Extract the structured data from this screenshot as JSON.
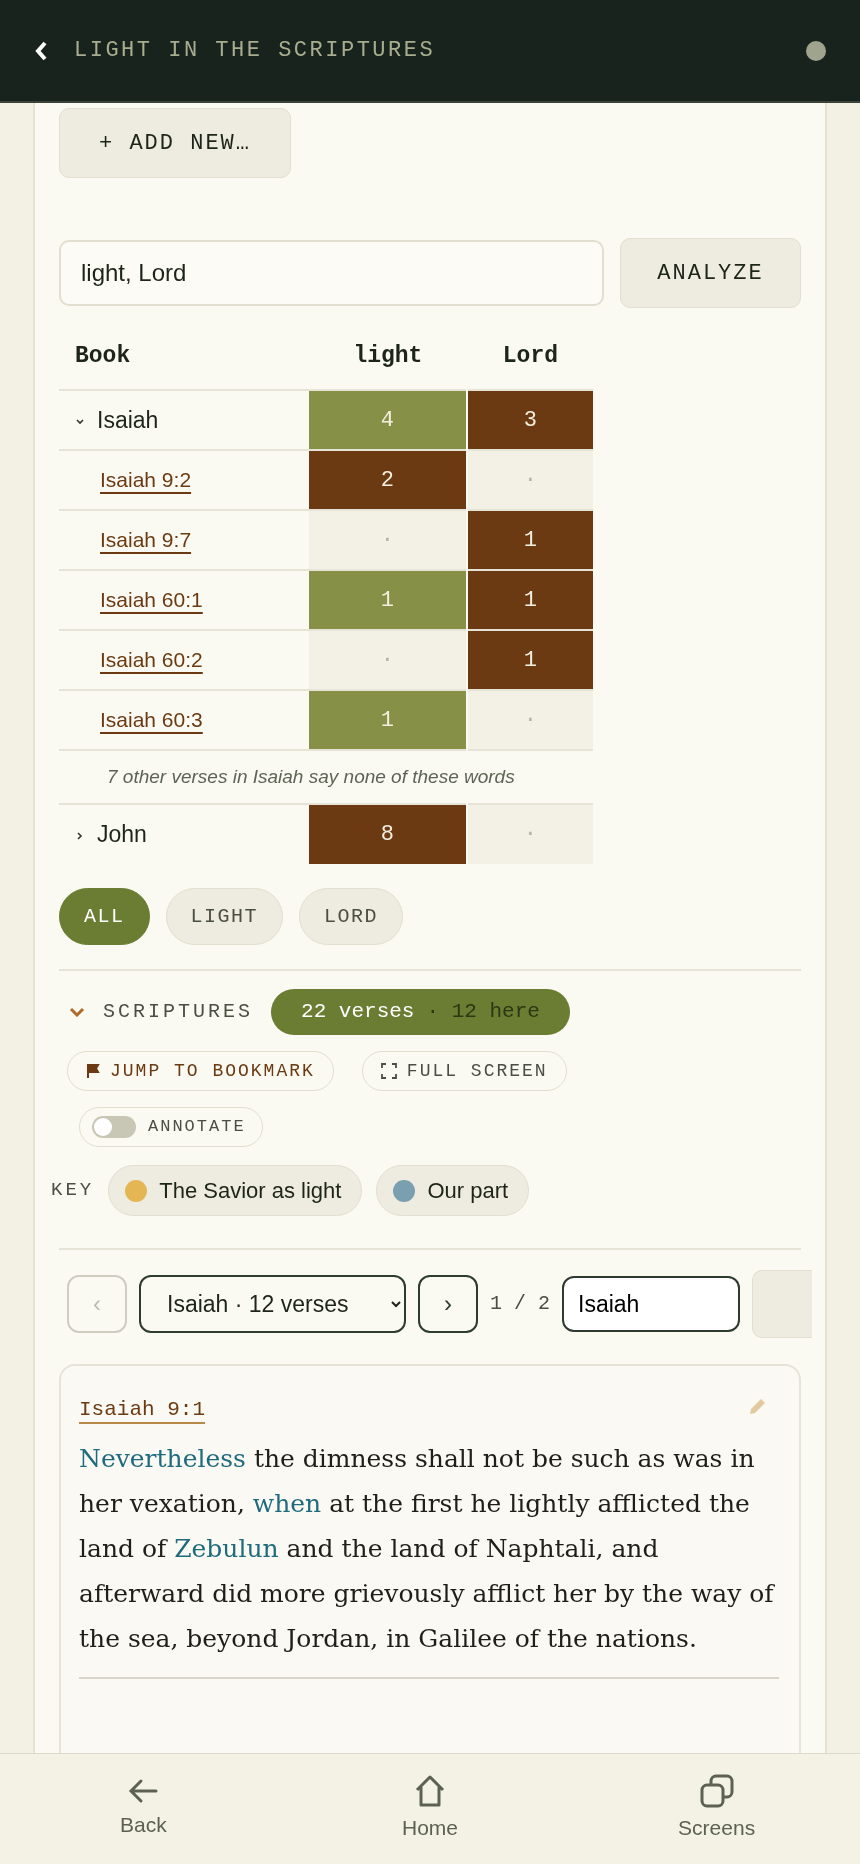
{
  "header": {
    "title": "LIGHT IN THE SCRIPTURES"
  },
  "add_button": "+ ADD NEW…",
  "search": {
    "value": "light, Lord",
    "button": "ANALYZE"
  },
  "table": {
    "columns": [
      "Book",
      "light",
      "Lord"
    ],
    "rows": [
      {
        "expanded": true,
        "cells": [
          {
            "value": "Isaiah"
          },
          {
            "value": "4",
            "color": "#869046"
          },
          {
            "value": "3",
            "color": "#6b3a12"
          }
        ],
        "children": [
          {
            "cells": [
              {
                "value": "Isaiah 9:2"
              },
              {
                "value": "2",
                "color": "#6b3a12"
              },
              {
                "value": "·"
              }
            ]
          },
          {
            "cells": [
              {
                "value": "Isaiah 9:7"
              },
              {
                "value": "·"
              },
              {
                "value": "1",
                "color": "#6b3a12"
              }
            ]
          },
          {
            "cells": [
              {
                "value": "Isaiah 60:1"
              },
              {
                "value": "1",
                "color": "#869046"
              },
              {
                "value": "1",
                "color": "#6b3a12"
              }
            ]
          },
          {
            "cells": [
              {
                "value": "Isaiah 60:2"
              },
              {
                "value": "·"
              },
              {
                "value": "1",
                "color": "#6b3a12"
              }
            ]
          },
          {
            "cells": [
              {
                "value": "Isaiah 60:3"
              },
              {
                "value": "1",
                "color": "#869046"
              },
              {
                "value": "·"
              }
            ]
          }
        ],
        "note": "7 other verses in Isaiah say none of these words"
      },
      {
        "expanded": false,
        "cells": [
          {
            "value": "John"
          },
          {
            "value": "8",
            "color": "#6b3a12"
          },
          {
            "value": "·"
          }
        ]
      }
    ]
  },
  "filters": [
    {
      "label": "ALL",
      "selected": true
    },
    {
      "label": "LIGHT",
      "selected": false
    },
    {
      "label": "LORD",
      "selected": false
    }
  ],
  "scriptures": {
    "label": "SCRIPTURES",
    "expanded": true,
    "count": "22 verses",
    "count_sub": "· 12 here",
    "actions": [
      {
        "kind": "bookmark",
        "label": "JUMP TO BOOKMARK"
      },
      {
        "kind": "fullscreen",
        "label": "FULL SCREEN"
      }
    ],
    "annotate": {
      "label": "ANNOTATE",
      "on": false
    },
    "key": {
      "label": "KEY",
      "items": [
        {
          "label": "The Savior as light",
          "color": "#e4b654"
        },
        {
          "label": "Our part",
          "color": "#7a9fb0"
        }
      ]
    }
  },
  "navigator": {
    "prev": {
      "label": "‹",
      "disabled": true
    },
    "select": "Isaiah · 12 verses",
    "next": {
      "label": "›",
      "disabled": false
    },
    "page": "1 / 2",
    "book_field": "Isaiah"
  },
  "verse": {
    "reference": "Isaiah 9:1",
    "segments": [
      {
        "text": "Nevertheless",
        "highlighted": true
      },
      {
        "text": " the dimness shall not be such as was in her vexation, ",
        "highlighted": false
      },
      {
        "text": "when",
        "highlighted": true
      },
      {
        "text": " at the first he lightly afflicted the land of ",
        "highlighted": false
      },
      {
        "text": "Zebulun",
        "highlighted": true
      },
      {
        "text": " and the land of Naphtali, and afterward did more grievously afflict her by the way of the sea, beyond Jordan, in Galilee of the nations.",
        "highlighted": false
      }
    ]
  },
  "bottom_nav": [
    {
      "kind": "back",
      "label": "Back"
    },
    {
      "kind": "home",
      "label": "Home"
    },
    {
      "kind": "screens",
      "label": "Screens"
    }
  ]
}
